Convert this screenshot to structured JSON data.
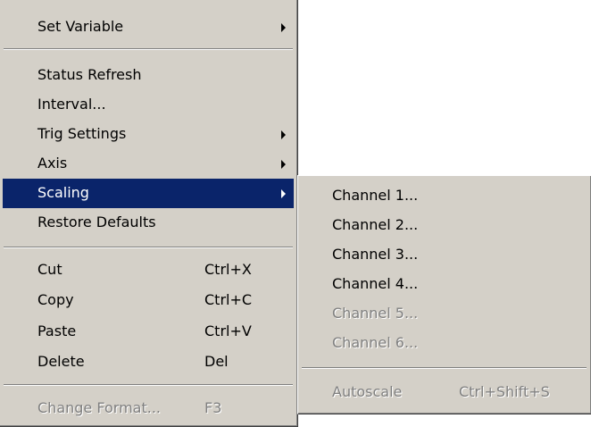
{
  "main_menu": {
    "items": [
      {
        "label": "Set Variable",
        "has_submenu": true
      },
      {
        "label": "Status Refresh"
      },
      {
        "label": "Interval..."
      },
      {
        "label": "Trig Settings",
        "has_submenu": true
      },
      {
        "label": "Axis",
        "has_submenu": true
      },
      {
        "label": "Scaling",
        "has_submenu": true,
        "selected": true
      },
      {
        "label": "Restore Defaults"
      },
      {
        "label": "Cut",
        "shortcut": "Ctrl+X"
      },
      {
        "label": "Copy",
        "shortcut": "Ctrl+C"
      },
      {
        "label": "Paste",
        "shortcut": "Ctrl+V"
      },
      {
        "label": "Delete",
        "shortcut": "Del"
      },
      {
        "label": "Change Format...",
        "shortcut": "F3",
        "disabled": true
      }
    ]
  },
  "sub_menu": {
    "items": [
      {
        "label": "Channel 1..."
      },
      {
        "label": "Channel 2..."
      },
      {
        "label": "Channel 3..."
      },
      {
        "label": "Channel 4..."
      },
      {
        "label": "Channel 5...",
        "disabled": true
      },
      {
        "label": "Channel 6...",
        "disabled": true
      },
      {
        "label": "Autoscale",
        "shortcut": "Ctrl+Shift+S",
        "disabled": true
      }
    ]
  },
  "colors": {
    "menu_background": "#d4d0c8",
    "selection": "#0a246a",
    "disabled_text": "#808080"
  }
}
